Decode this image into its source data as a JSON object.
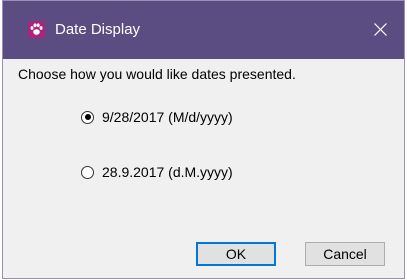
{
  "window": {
    "title": "Date Display",
    "app_icon": "paw-icon",
    "close_icon": "close-icon",
    "titlebar_color": "#5b4d82",
    "icon_color": "#a8247d"
  },
  "prompt": "Choose how you would like dates presented.",
  "options": [
    {
      "label": "9/28/2017 (M/d/yyyy)",
      "selected": true
    },
    {
      "label": "28.9.2017 (d.M.yyyy)",
      "selected": false
    }
  ],
  "buttons": {
    "ok_label": "OK",
    "cancel_label": "Cancel"
  }
}
